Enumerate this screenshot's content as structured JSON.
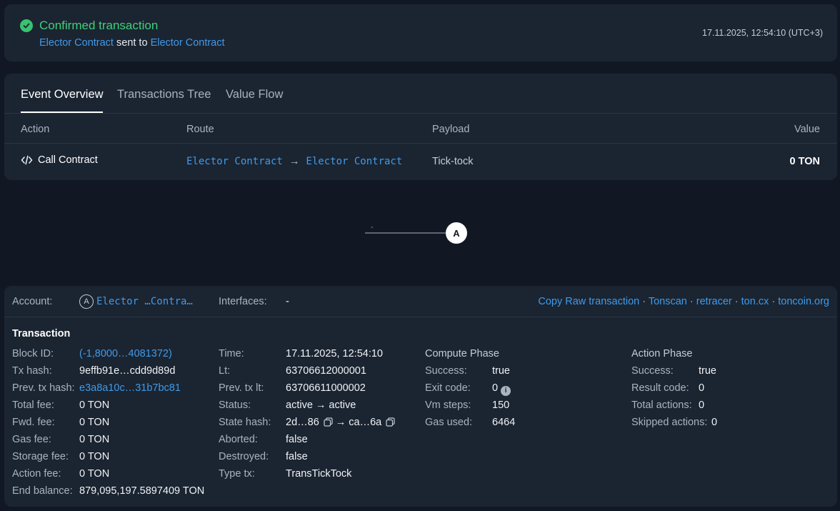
{
  "header": {
    "title": "Confirmed transaction",
    "from_link": "Elector Contract",
    "sent_to_text": "sent to",
    "to_link": "Elector Contract",
    "timestamp": "17.11.2025, 12:54:10 (UTC+3)"
  },
  "tabs": [
    {
      "label": "Event Overview"
    },
    {
      "label": "Transactions Tree"
    },
    {
      "label": "Value Flow"
    }
  ],
  "table": {
    "headers": {
      "action": "Action",
      "route": "Route",
      "payload": "Payload",
      "value": "Value"
    },
    "row": {
      "action": "Call Contract",
      "route_from": "Elector Contract",
      "route_arrow": "→",
      "route_to": "Elector Contract",
      "payload": "Tick-tock",
      "value": "0 TON"
    }
  },
  "graph": {
    "edge_label": "-",
    "node_label": "A"
  },
  "account": {
    "label": "Account:",
    "badge": "A",
    "name": "Elector …Contra…",
    "interfaces_label": "Interfaces:",
    "interfaces_value": "-",
    "links": [
      "Copy Raw transaction",
      "Tonscan",
      "retracer",
      "ton.cx",
      "toncoin.org"
    ],
    "link_separator": "·"
  },
  "transaction": {
    "title": "Transaction",
    "col1": [
      {
        "label": "Block ID:",
        "value": "(-1,8000…4081372)",
        "link": true
      },
      {
        "label": "Tx hash:",
        "value": "9effb91e…cdd9d89d"
      },
      {
        "label": "Prev. tx hash:",
        "value": "e3a8a10c…31b7bc81",
        "link": true
      },
      {
        "label": "Total fee:",
        "value": "0 TON"
      },
      {
        "label": "Fwd. fee:",
        "value": "0 TON"
      },
      {
        "label": "Gas fee:",
        "value": "0 TON"
      },
      {
        "label": "Storage fee:",
        "value": "0 TON"
      },
      {
        "label": "Action fee:",
        "value": "0 TON"
      },
      {
        "label": "End balance:",
        "value": "879,095,197.5897409 TON"
      }
    ],
    "col2": {
      "time_label": "Time:",
      "time_value": "17.11.2025, 12:54:10",
      "lt_label": "Lt:",
      "lt_value": "63706612000001",
      "prev_lt_label": "Prev. tx lt:",
      "prev_lt_value": "63706611000002",
      "status_label": "Status:",
      "status_value": "active → active",
      "state_hash_label": "State hash:",
      "state_hash_from": "2d…86",
      "state_hash_arrow": "→",
      "state_hash_to": "ca…6a",
      "aborted_label": "Aborted:",
      "aborted_value": "false",
      "destroyed_label": "Destroyed:",
      "destroyed_value": "false",
      "type_label": "Type tx:",
      "type_value": "TransTickTock"
    },
    "compute": {
      "title": "Compute Phase",
      "success_label": "Success:",
      "success_value": "true",
      "exit_label": "Exit code:",
      "exit_value": "0",
      "vm_label": "Vm steps:",
      "vm_value": "150",
      "gas_label": "Gas used:",
      "gas_value": "6464"
    },
    "action": {
      "title": "Action Phase",
      "success_label": "Success:",
      "success_value": "true",
      "result_label": "Result code:",
      "result_value": "0",
      "total_label": "Total actions:",
      "total_value": "0",
      "skipped_label": "Skipped actions:",
      "skipped_value": "0"
    }
  },
  "colors": {
    "accent": "#3f9bea",
    "success": "#3dd17a",
    "bg": "#111823",
    "panel": "#1b2431"
  }
}
